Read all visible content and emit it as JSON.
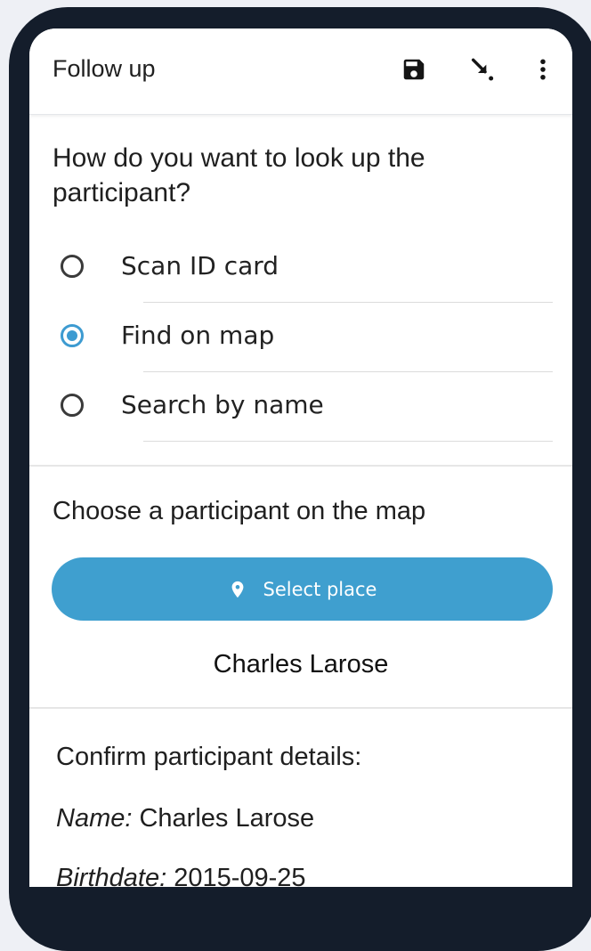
{
  "toolbar": {
    "title": "Follow up",
    "icons": [
      "save-icon",
      "jump-to-end-icon",
      "more-vert-icon"
    ]
  },
  "question": {
    "text": "How do you want to look up the participant?",
    "options": [
      {
        "label": "Scan ID card",
        "selected": false
      },
      {
        "label": "Find on map",
        "selected": true
      },
      {
        "label": "Search by name",
        "selected": false
      }
    ]
  },
  "map_section": {
    "prompt": "Choose a participant on the map",
    "button_label": "Select place",
    "button_icon": "location-pin-icon",
    "selected_name": "Charles Larose"
  },
  "details": {
    "title": "Confirm participant details:",
    "name_label": "Name:",
    "name_value": " Charles Larose",
    "birthdate_label": "Birthdate:",
    "birthdate_value": " 2015-09-25"
  },
  "colors": {
    "accent": "#3d9bd1",
    "button": "#3f9fcf",
    "frame": "#141d2b"
  }
}
